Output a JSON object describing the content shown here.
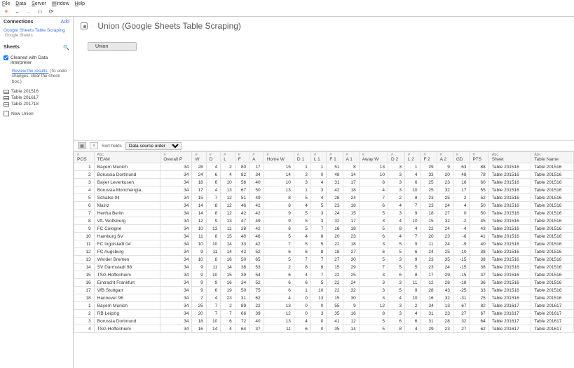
{
  "menu": [
    "File",
    "Data",
    "Server",
    "Window",
    "Help"
  ],
  "sidebar": {
    "connections_head": "Connections",
    "add": "Add",
    "connection": {
      "name": "Google Sheets Table Scraping",
      "sub": "Google Sheets"
    },
    "sheets_head": "Sheets",
    "cleaned": "Cleaned with Data Interpreter",
    "review_link": "Review the results.",
    "review_rest": " (To undo changes, clear the check box.)",
    "tables": [
      "Table 201516",
      "Table 201617",
      "Table 201718"
    ],
    "new_union": "New Union"
  },
  "page_title": "Union (Google Sheets Table Scraping)",
  "canvas_pill": "Union",
  "grid": {
    "sort_label": "Sort fields",
    "sort_value": "Data source order"
  },
  "columns": [
    {
      "type": "#",
      "name": "POS",
      "align": "r",
      "src": "*"
    },
    {
      "type": "Abc",
      "name": "TEAM",
      "align": "l",
      "src": "*"
    },
    {
      "type": "#",
      "name": "Overall P",
      "align": "r",
      "src": "union"
    },
    {
      "type": "#",
      "name": "W",
      "align": "r",
      "src": "union"
    },
    {
      "type": "#",
      "name": "D",
      "align": "r",
      "src": "union"
    },
    {
      "type": "#",
      "name": "L",
      "align": "r",
      "src": "union"
    },
    {
      "type": "#",
      "name": "F",
      "align": "r",
      "src": "union"
    },
    {
      "type": "#",
      "name": "A",
      "align": "r",
      "src": "union"
    },
    {
      "type": "#",
      "name": "Home W",
      "align": "r",
      "src": "union"
    },
    {
      "type": "#",
      "name": "D 1",
      "align": "r",
      "src": "union"
    },
    {
      "type": "#",
      "name": "L 1",
      "align": "r",
      "src": "union"
    },
    {
      "type": "#",
      "name": "F 1",
      "align": "r",
      "src": "union"
    },
    {
      "type": "#",
      "name": "A 1",
      "align": "r",
      "src": "union"
    },
    {
      "type": "#",
      "name": "Away W",
      "align": "r",
      "src": "union"
    },
    {
      "type": "#",
      "name": "D 2",
      "align": "r",
      "src": "union"
    },
    {
      "type": "#",
      "name": "L 2",
      "align": "r",
      "src": "union"
    },
    {
      "type": "#",
      "name": "F 2",
      "align": "r",
      "src": "union"
    },
    {
      "type": "#",
      "name": "A 2",
      "align": "r",
      "src": "union"
    },
    {
      "type": "#",
      "name": "GD",
      "align": "r",
      "src": "union"
    },
    {
      "type": "#",
      "name": "PTS",
      "align": "r",
      "src": "union"
    },
    {
      "type": "Abc",
      "name": "Sheet",
      "align": "l",
      "src": "*"
    },
    {
      "type": "Abc",
      "name": "Table Name",
      "align": "l",
      "src": "*"
    }
  ],
  "rows": [
    [
      1,
      "Bayern Munich",
      34,
      28,
      4,
      2,
      80,
      17,
      15,
      1,
      1,
      51,
      8,
      13,
      3,
      1,
      29,
      9,
      63,
      88,
      "Table 201516",
      "Table 201516"
    ],
    [
      2,
      "Borussia Dortmund",
      34,
      24,
      6,
      4,
      82,
      34,
      14,
      3,
      0,
      48,
      14,
      10,
      3,
      4,
      33,
      20,
      48,
      78,
      "Table 201516",
      "Table 201516"
    ],
    [
      3,
      "Bayer Leverkusen",
      34,
      18,
      6,
      10,
      56,
      40,
      10,
      3,
      4,
      31,
      17,
      8,
      3,
      6,
      25,
      23,
      16,
      60,
      "Table 201516",
      "Table 201516"
    ],
    [
      4,
      "Borussia Monchengla..",
      34,
      17,
      4,
      13,
      67,
      50,
      13,
      1,
      3,
      42,
      18,
      4,
      3,
      10,
      25,
      32,
      17,
      55,
      "Table 201516",
      "Table 201516"
    ],
    [
      5,
      "Schalke 04",
      34,
      15,
      7,
      12,
      51,
      49,
      8,
      5,
      4,
      28,
      24,
      7,
      2,
      8,
      23,
      25,
      2,
      52,
      "Table 201516",
      "Table 201516"
    ],
    [
      6,
      "Mainz",
      34,
      14,
      8,
      12,
      46,
      42,
      8,
      4,
      5,
      23,
      18,
      6,
      4,
      7,
      23,
      24,
      4,
      50,
      "Table 201516",
      "Table 201516"
    ],
    [
      7,
      "Hertha Berlin",
      34,
      14,
      8,
      12,
      42,
      42,
      9,
      5,
      3,
      24,
      15,
      5,
      3,
      9,
      18,
      27,
      0,
      50,
      "Table 201516",
      "Table 201516"
    ],
    [
      8,
      "VfL Wolfsburg",
      34,
      12,
      9,
      13,
      47,
      49,
      9,
      5,
      3,
      32,
      17,
      3,
      4,
      10,
      15,
      32,
      -2,
      45,
      "Table 201516",
      "Table 201516"
    ],
    [
      9,
      "FC Cologne",
      34,
      10,
      13,
      11,
      38,
      42,
      6,
      5,
      7,
      16,
      18,
      5,
      8,
      4,
      22,
      24,
      -4,
      43,
      "Table 201516",
      "Table 201516"
    ],
    [
      10,
      "Hamburg SV",
      34,
      11,
      8,
      15,
      40,
      46,
      5,
      4,
      8,
      20,
      23,
      6,
      4,
      7,
      20,
      23,
      -6,
      41,
      "Table 201516",
      "Table 201516"
    ],
    [
      11,
      "FC Ingolstadt 04",
      34,
      10,
      10,
      14,
      33,
      42,
      7,
      5,
      5,
      22,
      18,
      3,
      5,
      9,
      11,
      24,
      -9,
      40,
      "Table 201516",
      "Table 201516"
    ],
    [
      12,
      "FC Augsburg",
      34,
      9,
      11,
      14,
      42,
      52,
      6,
      6,
      8,
      18,
      27,
      6,
      5,
      6,
      24,
      25,
      -10,
      38,
      "Table 201516",
      "Table 201516"
    ],
    [
      13,
      "Werder Bremen",
      34,
      10,
      8,
      16,
      50,
      65,
      5,
      7,
      7,
      27,
      30,
      5,
      3,
      9,
      23,
      35,
      -15,
      38,
      "Table 201516",
      "Table 201516"
    ],
    [
      14,
      "SV Darmstadt 98",
      34,
      9,
      11,
      14,
      38,
      53,
      2,
      6,
      9,
      15,
      29,
      7,
      5,
      5,
      23,
      24,
      -15,
      38,
      "Table 201516",
      "Table 201516"
    ],
    [
      15,
      "TSG Hoffenheim",
      34,
      9,
      10,
      15,
      39,
      54,
      6,
      4,
      7,
      22,
      25,
      3,
      6,
      8,
      17,
      29,
      -15,
      37,
      "Table 201516",
      "Table 201516"
    ],
    [
      16,
      "Eintracht Frankfurt",
      34,
      9,
      9,
      16,
      34,
      52,
      6,
      6,
      5,
      22,
      24,
      3,
      3,
      11,
      12,
      28,
      -18,
      36,
      "Table 201516",
      "Table 201516"
    ],
    [
      17,
      "VfB Stuttgart",
      34,
      9,
      6,
      19,
      50,
      75,
      6,
      1,
      10,
      22,
      32,
      3,
      5,
      9,
      28,
      43,
      -25,
      33,
      "Table 201516",
      "Table 201516"
    ],
    [
      18,
      "Hannover 96",
      34,
      7,
      4,
      23,
      31,
      62,
      4,
      0,
      13,
      15,
      30,
      3,
      4,
      10,
      16,
      32,
      -31,
      25,
      "Table 201516",
      "Table 201516"
    ],
    [
      1,
      "Bayern Munich",
      34,
      25,
      7,
      2,
      89,
      22,
      13,
      0,
      0,
      55,
      9,
      12,
      3,
      2,
      34,
      13,
      67,
      82,
      "Table 201617",
      "Table 201617"
    ],
    [
      2,
      "RB Leipzig",
      34,
      20,
      7,
      7,
      66,
      39,
      12,
      0,
      3,
      35,
      16,
      8,
      3,
      4,
      31,
      23,
      27,
      67,
      "Table 201617",
      "Table 201617"
    ],
    [
      3,
      "Borussia Dortmund",
      34,
      18,
      10,
      6,
      72,
      40,
      13,
      4,
      0,
      41,
      12,
      5,
      6,
      6,
      31,
      28,
      32,
      64,
      "Table 201617",
      "Table 201617"
    ],
    [
      4,
      "TSG Hoffenheim",
      34,
      16,
      14,
      4,
      64,
      37,
      11,
      6,
      0,
      35,
      14,
      5,
      8,
      4,
      29,
      23,
      27,
      62,
      "Table 201617",
      "Table 201617"
    ]
  ]
}
